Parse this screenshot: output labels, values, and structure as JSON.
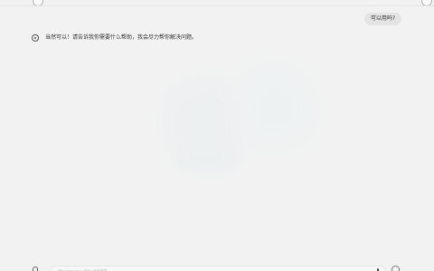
{
  "conversation": {
    "user_message": "可以用吗?",
    "assistant_message": "当然可以！请告诉我你需要什么帮助，我会尽力帮你解决问题。"
  },
  "composer": {
    "placeholder": "Message ChatGPT"
  },
  "icons": {
    "top_left": "circle-icon",
    "top_right": "circle-icon",
    "assistant": "assistant-avatar-icon",
    "attachment": "paperclip-icon",
    "voice": "microphone-icon",
    "send": "send-icon"
  }
}
